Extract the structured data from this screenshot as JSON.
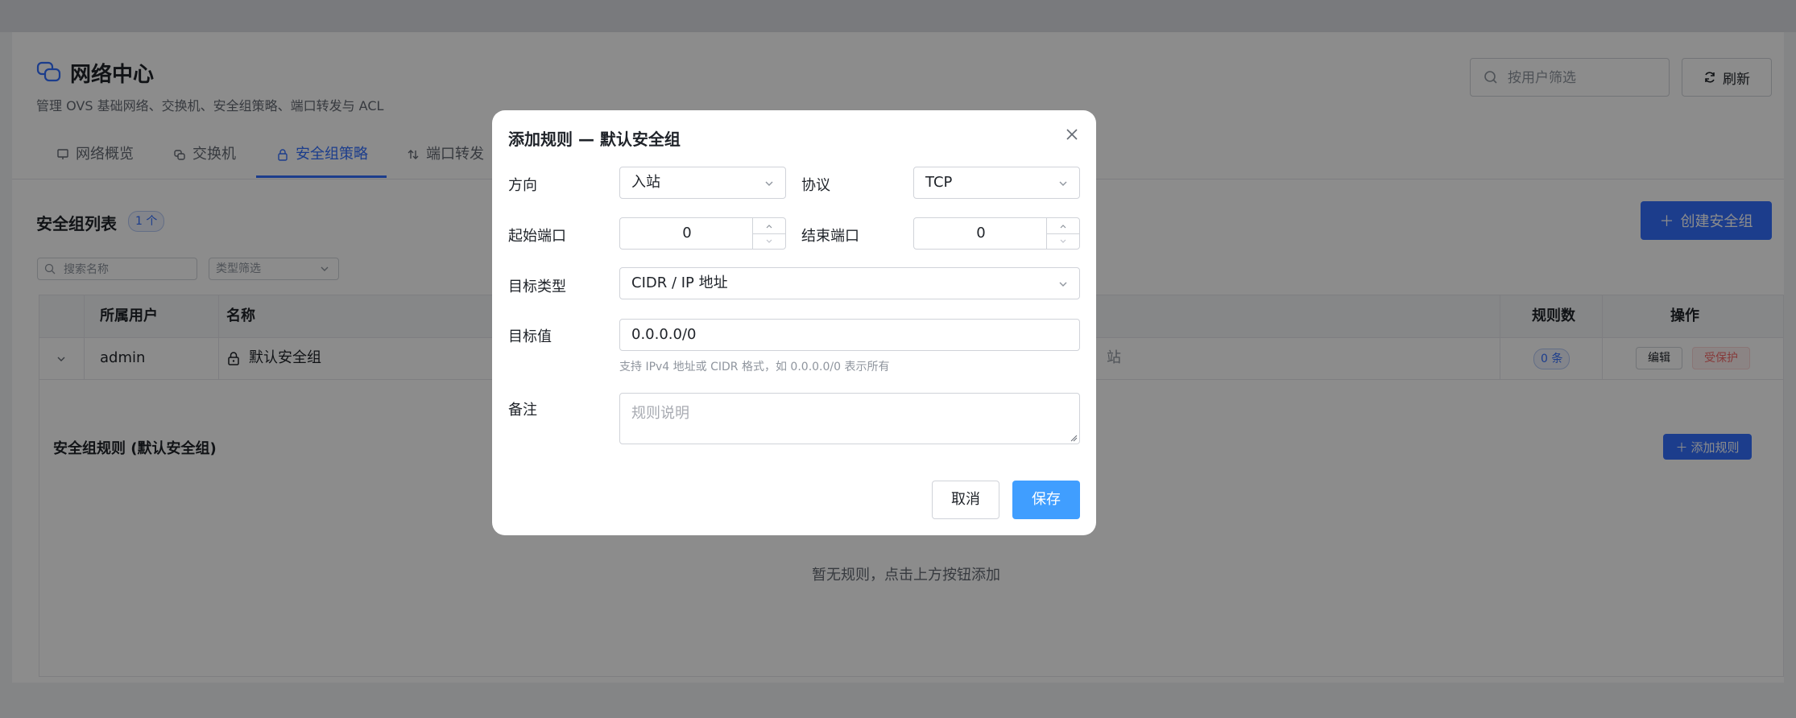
{
  "header": {
    "title": "网络中心",
    "subtitle": "管理 OVS 基础网络、交换机、安全组策略、端口转发与 ACL",
    "user_filter_placeholder": "按用户筛选",
    "refresh_label": "刷新"
  },
  "tabs": [
    {
      "label": "网络概览",
      "icon": "monitor-icon",
      "active": false
    },
    {
      "label": "交换机",
      "icon": "switch-icon",
      "active": false
    },
    {
      "label": "安全组策略",
      "icon": "lock-icon",
      "active": true
    },
    {
      "label": "端口转发",
      "icon": "port-forward-icon",
      "active": false
    }
  ],
  "security_groups": {
    "title": "安全组列表",
    "count": "1 个",
    "create_label": "创建安全组",
    "search_placeholder": "搜索名称",
    "type_filter_placeholder": "类型筛选",
    "columns": {
      "user": "所属用户",
      "name": "名称",
      "rule_count": "规则数",
      "actions": "操作"
    },
    "rows": [
      {
        "user": "admin",
        "name": "默认安全组",
        "partial_text": "站",
        "rule_count": "0 条",
        "edit_label": "编辑",
        "protected_label": "受保护"
      }
    ],
    "rules_title": "安全组规则 (默认安全组)",
    "add_rule_label": "添加规则",
    "empty_text": "暂无规则，点击上方按钮添加"
  },
  "dialog": {
    "title": "添加规则 — 默认安全组",
    "direction_label": "方向",
    "direction_value": "入站",
    "protocol_label": "协议",
    "protocol_value": "TCP",
    "start_port_label": "起始端口",
    "start_port_value": "0",
    "end_port_label": "结束端口",
    "end_port_value": "0",
    "target_type_label": "目标类型",
    "target_type_value": "CIDR / IP 地址",
    "target_value_label": "目标值",
    "target_value": "0.0.0.0/0",
    "target_hint": "支持 IPv4 地址或 CIDR 格式，如 0.0.0.0/0 表示所有",
    "note_label": "备注",
    "note_placeholder": "规则说明",
    "cancel_label": "取消",
    "save_label": "保存"
  },
  "colors": {
    "primary": "#3370ff",
    "save": "#409eff",
    "danger": "#f56c6c"
  }
}
